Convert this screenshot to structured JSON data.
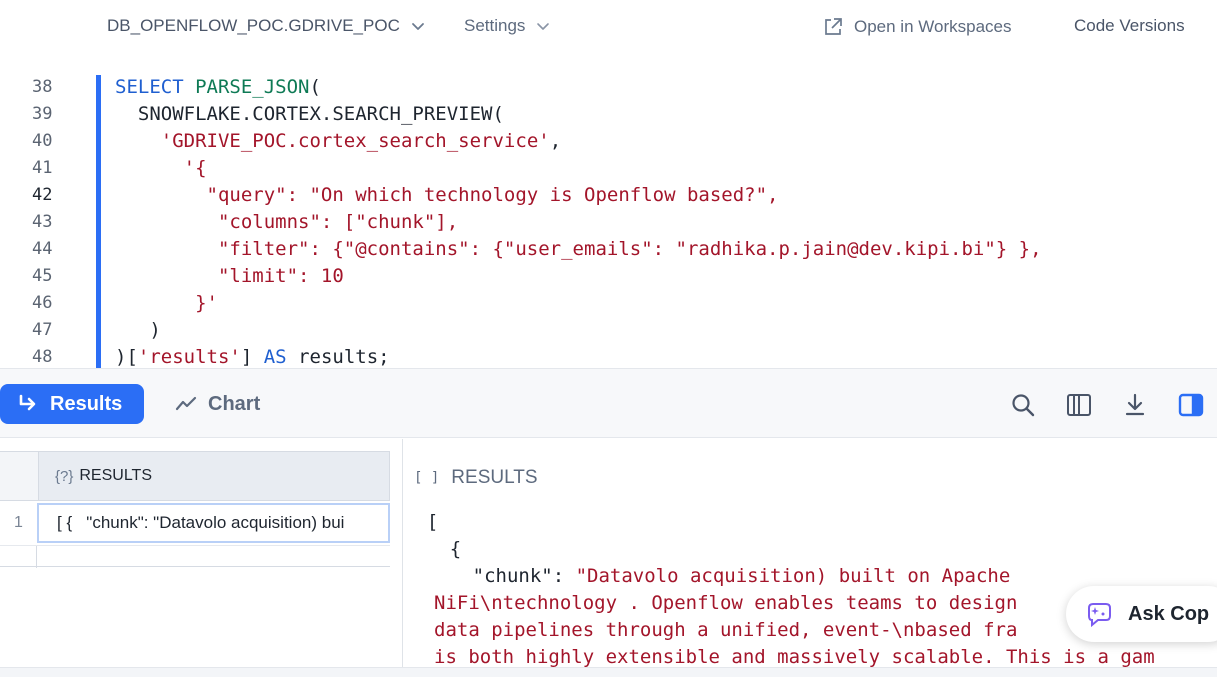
{
  "topbar": {
    "database": "DB_OPENFLOW_POC.GDRIVE_POC",
    "settings": "Settings",
    "open_workspaces": "Open in Workspaces",
    "code_versions": "Code Versions"
  },
  "editor": {
    "line_numbers": [
      "38",
      "39",
      "40",
      "41",
      "42",
      "43",
      "44",
      "45",
      "46",
      "47",
      "48"
    ],
    "active_line": "42",
    "lines": [
      [
        {
          "t": "SELECT ",
          "c": "kw"
        },
        {
          "t": "PARSE_JSON",
          "c": "fn"
        },
        {
          "t": "(",
          "c": "id"
        }
      ],
      [
        {
          "t": "  SNOWFLAKE.CORTEX.SEARCH_PREVIEW(",
          "c": "id"
        }
      ],
      [
        {
          "t": "    ",
          "c": "id"
        },
        {
          "t": "'GDRIVE_POC.cortex_search_service'",
          "c": "str"
        },
        {
          "t": ",",
          "c": "id"
        }
      ],
      [
        {
          "t": "      ",
          "c": "id"
        },
        {
          "t": "'{",
          "c": "str"
        }
      ],
      [
        {
          "t": "        ",
          "c": "id"
        },
        {
          "t": "\"query\": \"On which technology is Openflow based?\",",
          "c": "str"
        }
      ],
      [
        {
          "t": "         ",
          "c": "id"
        },
        {
          "t": "\"columns\": [\"chunk\"],",
          "c": "str"
        }
      ],
      [
        {
          "t": "         ",
          "c": "id"
        },
        {
          "t": "\"filter\": {\"@contains\": {\"user_emails\": \"radhika.p.jain@dev.kipi.bi\"} },",
          "c": "str"
        }
      ],
      [
        {
          "t": "         ",
          "c": "id"
        },
        {
          "t": "\"limit\": 10",
          "c": "str"
        }
      ],
      [
        {
          "t": "       ",
          "c": "id"
        },
        {
          "t": "}'",
          "c": "str"
        }
      ],
      [
        {
          "t": "   )",
          "c": "id"
        }
      ],
      [
        {
          "t": ")[",
          "c": "id"
        },
        {
          "t": "'results'",
          "c": "str"
        },
        {
          "t": "] ",
          "c": "id"
        },
        {
          "t": "AS",
          "c": "kw"
        },
        {
          "t": " results;",
          "c": "id"
        }
      ]
    ]
  },
  "toolbar": {
    "results_label": "Results",
    "chart_label": "Chart",
    "icons": [
      "search-icon",
      "columns-icon",
      "download-icon",
      "split-panel-icon"
    ]
  },
  "grid": {
    "column_type_icon": "{?}",
    "column_header": "RESULTS",
    "rows": [
      {
        "num": "1",
        "value": "[ {   \"chunk\": \"Datavolo acquisition) bui"
      }
    ]
  },
  "detail": {
    "type_icon": "[ ]",
    "header": "RESULTS",
    "lines": [
      [
        {
          "t": "  [",
          "c": "jpunct"
        }
      ],
      [
        {
          "t": "    {",
          "c": "jpunct"
        }
      ],
      [
        {
          "t": "      \"chunk\": ",
          "c": "jkey"
        },
        {
          "t": "\"Datavolo acquisition) built on Apache",
          "c": "jstr"
        }
      ],
      [
        {
          "t": "NiFi\\ntechnology . Openflow enables teams to design",
          "c": "jstr"
        }
      ],
      [
        {
          "t": "data pipelines through a unified, event-\\nbased fra",
          "c": "jstr"
        }
      ],
      [
        {
          "t": "is both highly extensible and massively scalable. This is a gam",
          "c": "jstr"
        }
      ]
    ]
  },
  "ask_copilot": "Ask Cop"
}
